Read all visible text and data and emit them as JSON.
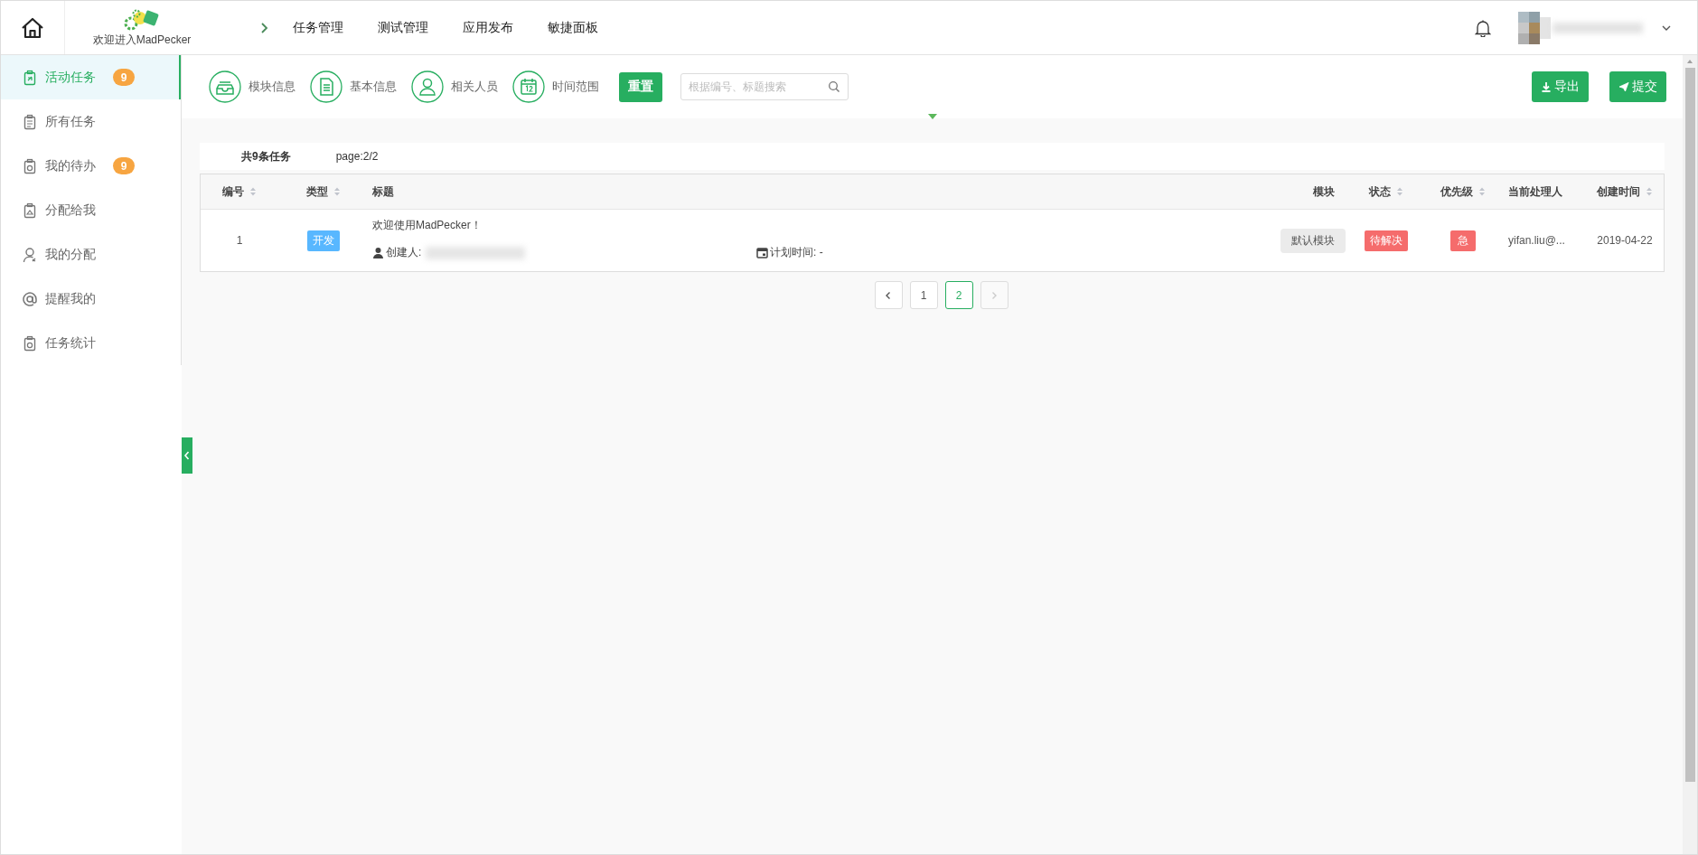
{
  "header": {
    "welcome": "欢迎进入MadPecker",
    "nav": [
      {
        "label": "任务管理"
      },
      {
        "label": "测试管理"
      },
      {
        "label": "应用发布"
      },
      {
        "label": "敏捷面板"
      }
    ]
  },
  "sidebar": {
    "items": [
      {
        "label": "活动任务",
        "badge": "9",
        "selected": true
      },
      {
        "label": "所有任务",
        "selected": false
      },
      {
        "label": "我的待办",
        "badge": "9",
        "selected": false
      },
      {
        "label": "分配给我",
        "selected": false
      },
      {
        "label": "我的分配",
        "selected": false
      },
      {
        "label": "提醒我的",
        "selected": false
      },
      {
        "label": "任务统计",
        "selected": false
      }
    ]
  },
  "toolbar": {
    "filters": [
      {
        "label": "模块信息"
      },
      {
        "label": "基本信息"
      },
      {
        "label": "相关人员"
      },
      {
        "label": "时间范围"
      }
    ],
    "reset": "重置",
    "search": {
      "placeholder": "根据编号、标题搜索"
    },
    "actions": [
      {
        "label": "导出"
      },
      {
        "label": "提交"
      }
    ]
  },
  "summary": {
    "total": "共9条任务",
    "page": "page:2/2"
  },
  "table": {
    "columns": [
      {
        "label": "编号",
        "sortable": true
      },
      {
        "label": "类型",
        "sortable": true
      },
      {
        "label": "标题",
        "sortable": false
      },
      {
        "label": "模块",
        "sortable": false
      },
      {
        "label": "状态",
        "sortable": true
      },
      {
        "label": "优先级",
        "sortable": true
      },
      {
        "label": "当前处理人",
        "sortable": false
      },
      {
        "label": "创建时间",
        "sortable": true
      }
    ],
    "rows": [
      {
        "id": "1",
        "type": {
          "label": "开发",
          "color": "#58b7ff"
        },
        "title": "欢迎使用MadPecker！",
        "creator_label": "创建人:",
        "plan_time": "计划时间: -",
        "module": "默认模块",
        "status": {
          "label": "待解决",
          "color": "#f56c6c"
        },
        "priority": {
          "label": "急",
          "color": "#f56c6c"
        },
        "assignee": "yifan.liu@...",
        "created": "2019-04-22"
      }
    ]
  },
  "pagination": {
    "pages": [
      {
        "label": "1",
        "selected": false
      },
      {
        "label": "2",
        "selected": true
      }
    ],
    "next_disabled": true
  }
}
